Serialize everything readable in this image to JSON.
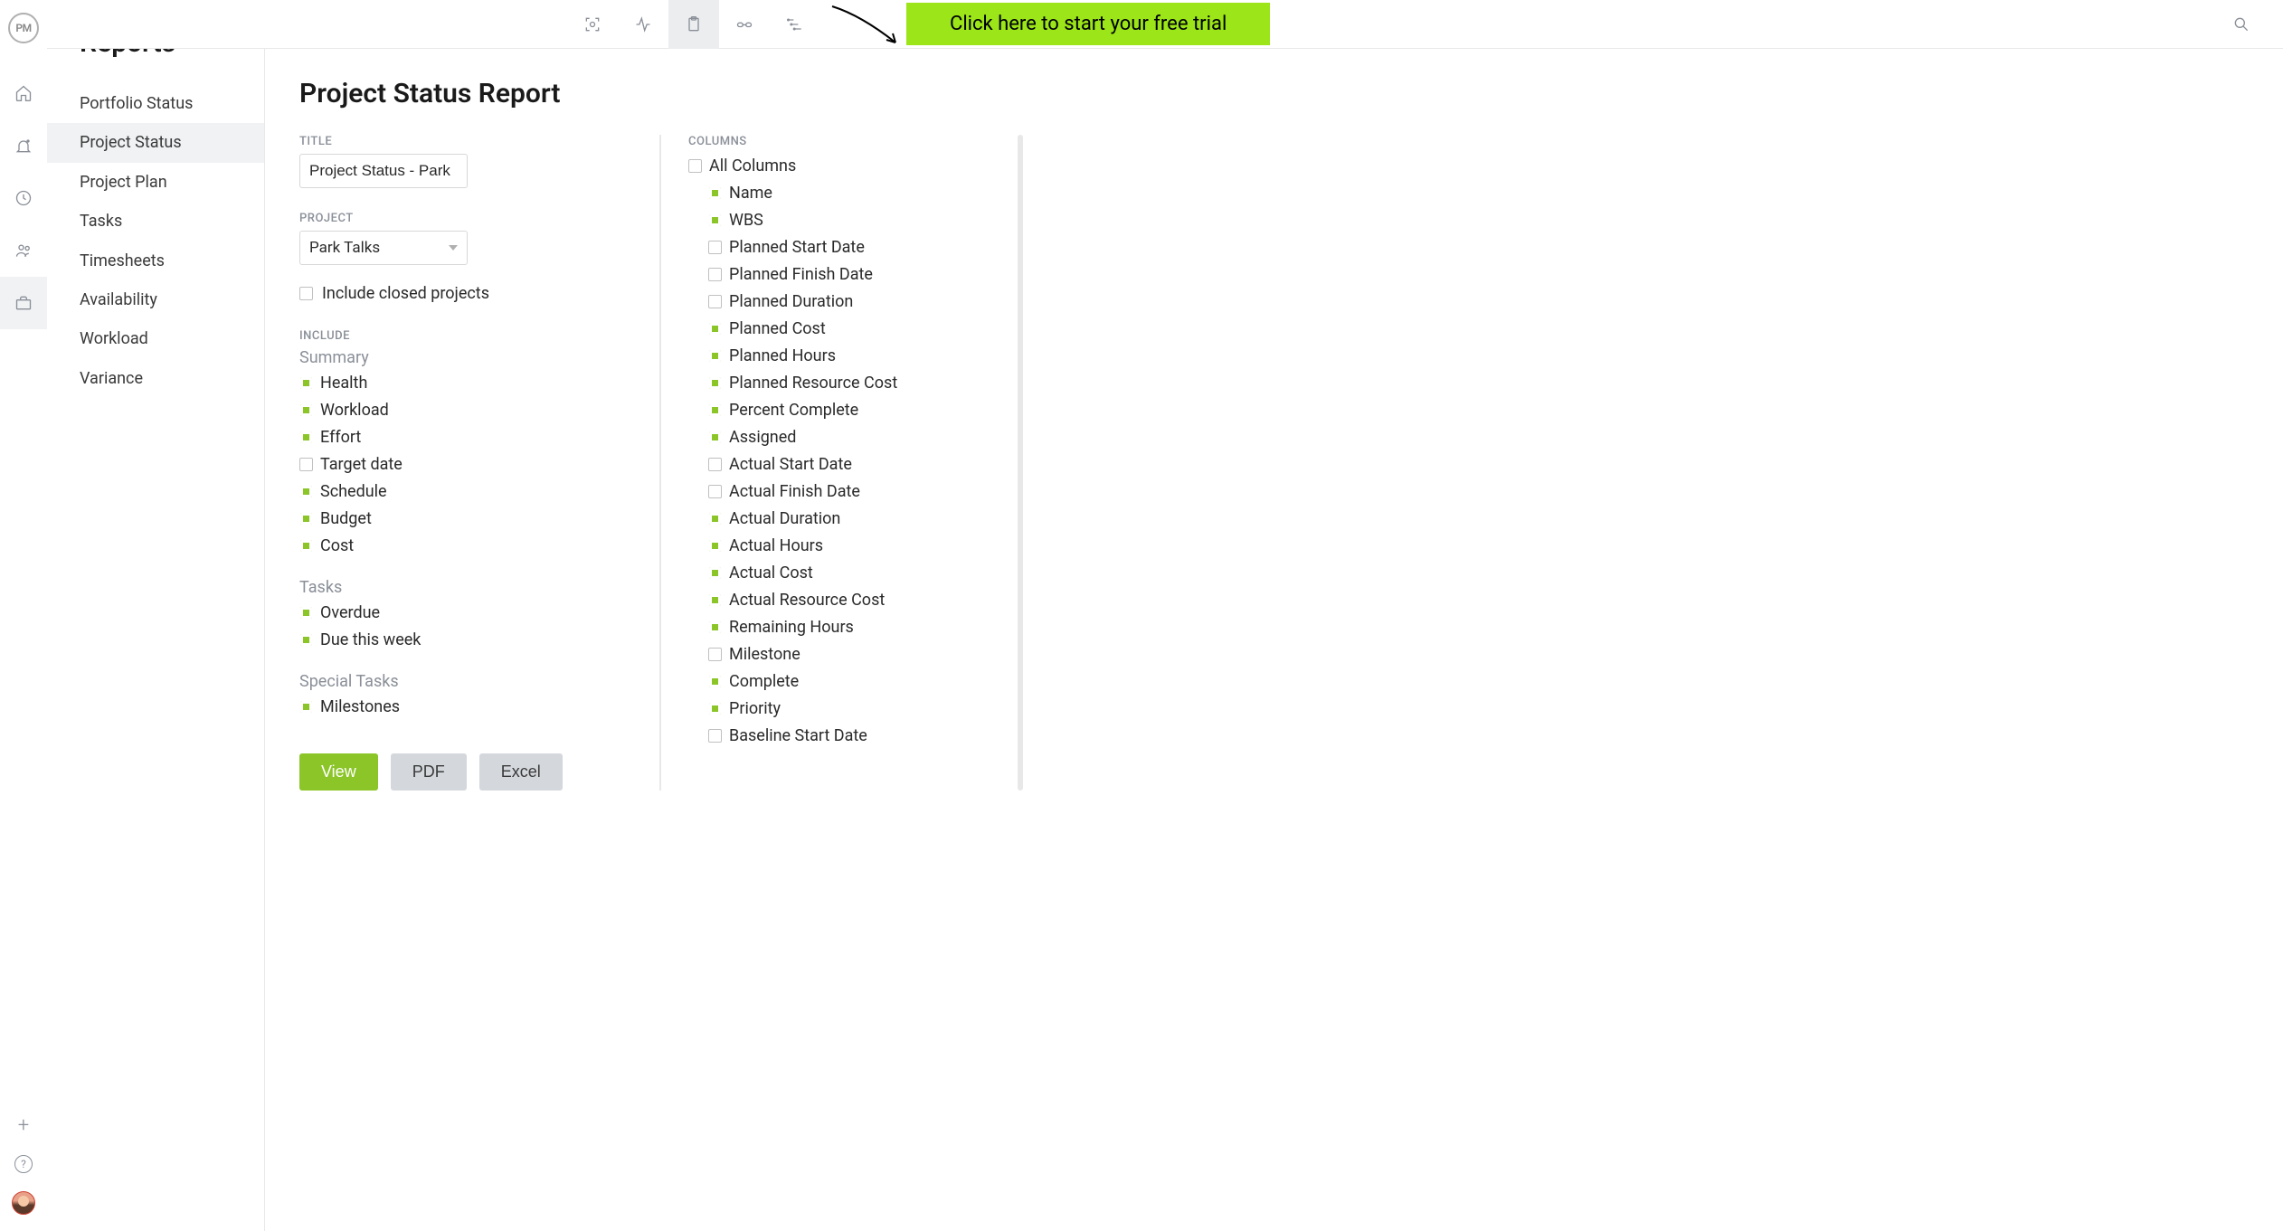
{
  "cta": {
    "label": "Click here to start your free trial"
  },
  "logo": "PM",
  "sidebar": {
    "title": "Reports",
    "items": [
      {
        "label": "Portfolio Status",
        "active": false
      },
      {
        "label": "Project Status",
        "active": true
      },
      {
        "label": "Project Plan",
        "active": false
      },
      {
        "label": "Tasks",
        "active": false
      },
      {
        "label": "Timesheets",
        "active": false
      },
      {
        "label": "Availability",
        "active": false
      },
      {
        "label": "Workload",
        "active": false
      },
      {
        "label": "Variance",
        "active": false
      }
    ]
  },
  "page": {
    "title": "Project Status Report",
    "titleLabel": "TITLE",
    "titleValue": "Project Status - Park",
    "projectLabel": "PROJECT",
    "projectValue": "Park Talks",
    "includeClosed": {
      "label": "Include closed projects",
      "checked": false
    },
    "includeLabel": "INCLUDE",
    "summaryHeader": "Summary",
    "summary": [
      {
        "label": "Health",
        "checked": true
      },
      {
        "label": "Workload",
        "checked": true
      },
      {
        "label": "Effort",
        "checked": true
      },
      {
        "label": "Target date",
        "checked": false
      },
      {
        "label": "Schedule",
        "checked": true
      },
      {
        "label": "Budget",
        "checked": true
      },
      {
        "label": "Cost",
        "checked": true
      }
    ],
    "tasksHeader": "Tasks",
    "tasks": [
      {
        "label": "Overdue",
        "checked": true
      },
      {
        "label": "Due this week",
        "checked": true
      }
    ],
    "specialHeader": "Special Tasks",
    "special": [
      {
        "label": "Milestones",
        "checked": true
      }
    ],
    "columnsLabel": "COLUMNS",
    "allColumns": {
      "label": "All Columns",
      "checked": false
    },
    "columns": [
      {
        "label": "Name",
        "checked": true
      },
      {
        "label": "WBS",
        "checked": true
      },
      {
        "label": "Planned Start Date",
        "checked": false
      },
      {
        "label": "Planned Finish Date",
        "checked": false
      },
      {
        "label": "Planned Duration",
        "checked": false
      },
      {
        "label": "Planned Cost",
        "checked": true
      },
      {
        "label": "Planned Hours",
        "checked": true
      },
      {
        "label": "Planned Resource Cost",
        "checked": true
      },
      {
        "label": "Percent Complete",
        "checked": true
      },
      {
        "label": "Assigned",
        "checked": true
      },
      {
        "label": "Actual Start Date",
        "checked": false
      },
      {
        "label": "Actual Finish Date",
        "checked": false
      },
      {
        "label": "Actual Duration",
        "checked": true
      },
      {
        "label": "Actual Hours",
        "checked": true
      },
      {
        "label": "Actual Cost",
        "checked": true
      },
      {
        "label": "Actual Resource Cost",
        "checked": true
      },
      {
        "label": "Remaining Hours",
        "checked": true
      },
      {
        "label": "Milestone",
        "checked": false
      },
      {
        "label": "Complete",
        "checked": true
      },
      {
        "label": "Priority",
        "checked": true
      },
      {
        "label": "Baseline Start Date",
        "checked": false
      }
    ],
    "buttons": {
      "view": "View",
      "pdf": "PDF",
      "excel": "Excel"
    }
  }
}
